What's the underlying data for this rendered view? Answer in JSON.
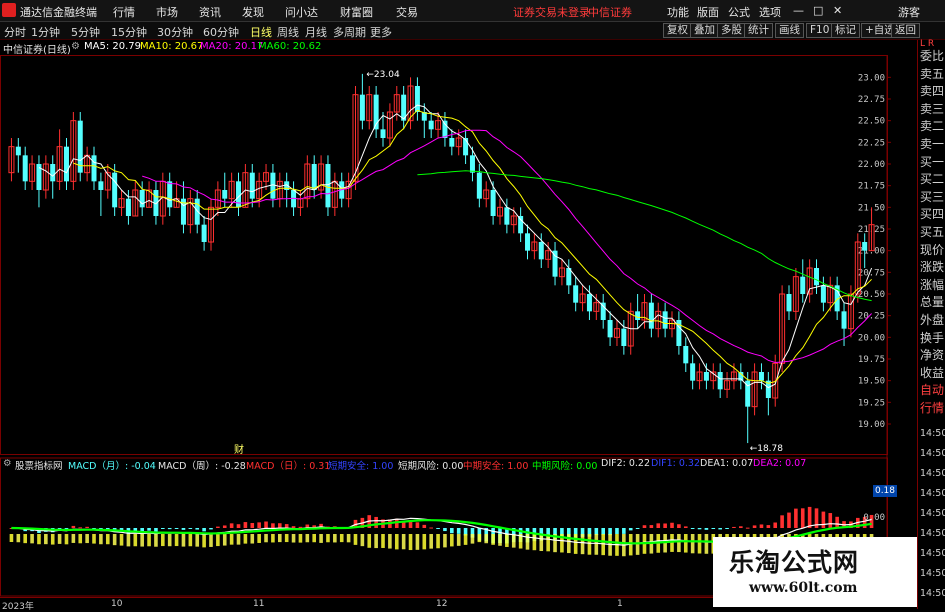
{
  "menubar": {
    "app_title": "通达信金融终端",
    "menus": [
      "行情",
      "市场",
      "资讯",
      "发现",
      "问小达",
      "财富圈",
      "交易"
    ],
    "notice": [
      "证券交易未登录",
      "中信证券"
    ],
    "right_menus": [
      "功能",
      "版面",
      "公式",
      "选项"
    ],
    "window_controls": [
      "—",
      "□",
      "✕"
    ],
    "user": "游客"
  },
  "toolbar": {
    "periods": [
      "分时",
      "1分钟",
      "5分钟",
      "15分钟",
      "30分钟",
      "60分钟",
      "日线",
      "周线",
      "月线",
      "多周期",
      "更多"
    ],
    "active_period": "日线",
    "right_buttons": [
      "复权",
      "叠加",
      "多股",
      "统计",
      "画线",
      "F10",
      "标记",
      "+自选",
      "返回"
    ]
  },
  "main_info": {
    "stock": "中信证券(日线)",
    "ma5": "MA5: 20.79",
    "ma10": "MA10: 20.67",
    "ma20": "MA20: 20.17",
    "ma60": "MA60: 20.62"
  },
  "colors": {
    "up": "#ff3030",
    "down": "#54ffff",
    "ma5": "#ffffff",
    "ma10": "#ffff00",
    "ma20": "#ff00ff",
    "ma60": "#00ff00",
    "grid": "#7a0000",
    "axis_text": "#c8c8c8"
  },
  "price_axis": [
    "23.00",
    "22.75",
    "22.50",
    "22.25",
    "22.00",
    "21.75",
    "21.50",
    "21.25",
    "21.00",
    "20.75",
    "20.50",
    "20.25",
    "20.00",
    "19.75",
    "19.50",
    "19.25",
    "19.00"
  ],
  "annotations": {
    "high": "23.04",
    "low": "18.78",
    "cai_marker": "财"
  },
  "right_panel": {
    "labels": [
      "委比",
      "卖五",
      "卖四",
      "卖三",
      "卖二",
      "卖一",
      "买一",
      "买二",
      "买三",
      "买四",
      "买五",
      "现价",
      "涨跌",
      "涨幅",
      "总量",
      "外盘",
      "换手",
      "净资",
      "收益",
      "自动",
      "行情"
    ],
    "header": "L\nR",
    "times": [
      "14:50",
      "14:50",
      "14:50",
      "14:50",
      "14:50",
      "14:50",
      "14:50",
      "14:50",
      "14:50"
    ]
  },
  "sub_info": {
    "name": "股票指标网",
    "macd_month": "MACD（月）: -0.04",
    "macd_week": "MACD（周）: -0.28",
    "macd_day": "MACD（日）: 0.31",
    "long_safe": "短期安全: 1.00",
    "short_risk": "短期风险: 0.00",
    "mid_safe": "中期安全: 1.00",
    "mid_risk": "中期风险: 0.00",
    "dif2": "DIF2: 0.22",
    "dif1": "DIF1: 0.32",
    "dea1": "DEA1: 0.07",
    "dea2": "DEA2: 0.07",
    "value_badge": "0.18",
    "sub_axis": [
      "0.00",
      "0.00"
    ]
  },
  "x_axis": [
    "2023年",
    "10",
    "11",
    "12",
    "1"
  ],
  "watermark": {
    "line1": "乐淘公式网",
    "line2": "www.60lt.com"
  },
  "chart_data": {
    "type": "candlestick",
    "ylim": [
      18.7,
      23.2
    ],
    "candles": [
      [
        21.9,
        22.2,
        22.3,
        21.8
      ],
      [
        22.2,
        22.1,
        22.3,
        21.9
      ],
      [
        22.1,
        21.8,
        22.2,
        21.7
      ],
      [
        21.8,
        22.0,
        22.1,
        21.7
      ],
      [
        22.0,
        21.7,
        22.1,
        21.5
      ],
      [
        21.7,
        22.0,
        22.1,
        21.6
      ],
      [
        22.0,
        21.8,
        22.1,
        21.6
      ],
      [
        21.8,
        22.2,
        22.4,
        21.7
      ],
      [
        22.2,
        21.8,
        22.3,
        21.7
      ],
      [
        21.8,
        22.5,
        22.6,
        21.7
      ],
      [
        22.5,
        21.9,
        22.6,
        21.8
      ],
      [
        21.9,
        22.1,
        22.2,
        21.8
      ],
      [
        22.1,
        21.8,
        22.2,
        21.7
      ],
      [
        21.8,
        21.7,
        21.9,
        21.4
      ],
      [
        21.7,
        21.9,
        22.0,
        21.6
      ],
      [
        21.9,
        21.5,
        22.0,
        21.4
      ],
      [
        21.5,
        21.6,
        21.7,
        21.4
      ],
      [
        21.6,
        21.4,
        21.7,
        21.3
      ],
      [
        21.4,
        21.7,
        21.8,
        21.4
      ],
      [
        21.7,
        21.5,
        21.8,
        21.4
      ],
      [
        21.5,
        21.7,
        21.8,
        21.5
      ],
      [
        21.7,
        21.4,
        21.8,
        21.3
      ],
      [
        21.4,
        21.8,
        21.9,
        21.3
      ],
      [
        21.8,
        21.5,
        21.9,
        21.4
      ],
      [
        21.5,
        21.6,
        21.8,
        21.5
      ],
      [
        21.6,
        21.3,
        21.8,
        21.2
      ],
      [
        21.3,
        21.6,
        21.7,
        21.2
      ],
      [
        21.6,
        21.3,
        21.7,
        21.2
      ],
      [
        21.3,
        21.1,
        21.4,
        21.0
      ],
      [
        21.1,
        21.5,
        21.6,
        21.0
      ],
      [
        21.5,
        21.7,
        21.8,
        21.4
      ],
      [
        21.7,
        21.6,
        21.9,
        21.5
      ],
      [
        21.6,
        21.8,
        21.9,
        21.5
      ],
      [
        21.8,
        21.5,
        21.9,
        21.4
      ],
      [
        21.5,
        21.9,
        22.0,
        21.5
      ],
      [
        21.9,
        21.6,
        22.0,
        21.5
      ],
      [
        21.6,
        21.8,
        21.9,
        21.5
      ],
      [
        21.8,
        21.9,
        22.0,
        21.7
      ],
      [
        21.9,
        21.6,
        22.0,
        21.5
      ],
      [
        21.6,
        21.8,
        21.9,
        21.5
      ],
      [
        21.8,
        21.7,
        21.9,
        21.5
      ],
      [
        21.7,
        21.5,
        21.8,
        21.4
      ],
      [
        21.5,
        21.6,
        21.7,
        21.4
      ],
      [
        21.6,
        22.0,
        22.1,
        21.5
      ],
      [
        22.0,
        21.7,
        22.1,
        21.6
      ],
      [
        21.7,
        22.0,
        22.1,
        21.6
      ],
      [
        22.0,
        21.5,
        22.1,
        21.4
      ],
      [
        21.5,
        21.8,
        21.9,
        21.4
      ],
      [
        21.8,
        21.6,
        21.9,
        21.5
      ],
      [
        21.6,
        21.8,
        21.9,
        21.5
      ],
      [
        21.8,
        22.8,
        22.9,
        21.7
      ],
      [
        22.8,
        22.5,
        23.04,
        22.4
      ],
      [
        22.5,
        22.8,
        22.9,
        22.4
      ],
      [
        22.8,
        22.4,
        22.9,
        22.3
      ],
      [
        22.4,
        22.3,
        22.6,
        22.2
      ],
      [
        22.3,
        22.6,
        22.7,
        22.2
      ],
      [
        22.6,
        22.8,
        22.9,
        22.5
      ],
      [
        22.8,
        22.5,
        22.9,
        22.4
      ],
      [
        22.5,
        22.9,
        23.0,
        22.4
      ],
      [
        22.9,
        22.6,
        23.0,
        22.5
      ],
      [
        22.6,
        22.5,
        22.7,
        22.3
      ],
      [
        22.5,
        22.4,
        22.6,
        22.3
      ],
      [
        22.4,
        22.5,
        22.6,
        22.3
      ],
      [
        22.5,
        22.3,
        22.6,
        22.2
      ],
      [
        22.3,
        22.2,
        22.4,
        22.1
      ],
      [
        22.2,
        22.3,
        22.4,
        22.1
      ],
      [
        22.3,
        22.1,
        22.4,
        22.0
      ],
      [
        22.1,
        21.9,
        22.2,
        21.8
      ],
      [
        21.9,
        21.6,
        22.0,
        21.5
      ],
      [
        21.6,
        21.7,
        21.8,
        21.5
      ],
      [
        21.7,
        21.4,
        21.8,
        21.3
      ],
      [
        21.4,
        21.5,
        21.6,
        21.3
      ],
      [
        21.5,
        21.3,
        21.6,
        21.2
      ],
      [
        21.3,
        21.4,
        21.5,
        21.2
      ],
      [
        21.4,
        21.2,
        21.5,
        21.1
      ],
      [
        21.2,
        21.0,
        21.3,
        20.9
      ],
      [
        21.0,
        21.1,
        21.2,
        20.9
      ],
      [
        21.1,
        20.9,
        21.2,
        20.8
      ],
      [
        20.9,
        21.0,
        21.1,
        20.8
      ],
      [
        21.0,
        20.7,
        21.1,
        20.6
      ],
      [
        20.7,
        20.8,
        20.9,
        20.6
      ],
      [
        20.8,
        20.6,
        20.9,
        20.5
      ],
      [
        20.6,
        20.4,
        20.7,
        20.3
      ],
      [
        20.4,
        20.5,
        20.6,
        20.3
      ],
      [
        20.5,
        20.3,
        20.6,
        20.2
      ],
      [
        20.3,
        20.4,
        20.5,
        20.2
      ],
      [
        20.4,
        20.2,
        20.5,
        20.1
      ],
      [
        20.2,
        20.0,
        20.3,
        19.9
      ],
      [
        20.0,
        20.1,
        20.2,
        19.9
      ],
      [
        20.1,
        19.9,
        20.2,
        19.8
      ],
      [
        19.9,
        20.3,
        20.4,
        19.8
      ],
      [
        20.3,
        20.2,
        20.5,
        20.1
      ],
      [
        20.2,
        20.4,
        20.5,
        20.1
      ],
      [
        20.4,
        20.1,
        20.5,
        20.0
      ],
      [
        20.1,
        20.3,
        20.4,
        20.0
      ],
      [
        20.3,
        20.1,
        20.4,
        20.0
      ],
      [
        20.1,
        20.2,
        20.3,
        20.0
      ],
      [
        20.2,
        19.9,
        20.3,
        19.8
      ],
      [
        19.9,
        19.7,
        20.0,
        19.6
      ],
      [
        19.7,
        19.5,
        19.8,
        19.4
      ],
      [
        19.5,
        19.6,
        19.7,
        19.4
      ],
      [
        19.6,
        19.5,
        19.7,
        19.4
      ],
      [
        19.5,
        19.6,
        19.7,
        19.4
      ],
      [
        19.6,
        19.4,
        19.7,
        19.3
      ],
      [
        19.4,
        19.5,
        19.6,
        19.3
      ],
      [
        19.5,
        19.6,
        19.7,
        19.4
      ],
      [
        19.6,
        19.5,
        19.7,
        19.4
      ],
      [
        19.5,
        19.2,
        19.6,
        18.78
      ],
      [
        19.2,
        19.6,
        19.7,
        19.1
      ],
      [
        19.6,
        19.5,
        19.7,
        19.4
      ],
      [
        19.5,
        19.3,
        19.6,
        19.1
      ],
      [
        19.3,
        19.7,
        19.8,
        19.2
      ],
      [
        19.7,
        20.5,
        20.6,
        19.6
      ],
      [
        20.5,
        20.3,
        20.6,
        20.2
      ],
      [
        20.3,
        20.7,
        20.8,
        20.2
      ],
      [
        20.7,
        20.5,
        20.9,
        20.4
      ],
      [
        20.5,
        20.8,
        20.9,
        20.4
      ],
      [
        20.8,
        20.6,
        20.9,
        20.5
      ],
      [
        20.6,
        20.4,
        20.7,
        20.3
      ],
      [
        20.4,
        20.6,
        20.7,
        20.3
      ],
      [
        20.6,
        20.3,
        20.7,
        20.2
      ],
      [
        20.3,
        20.1,
        20.4,
        19.9
      ],
      [
        20.1,
        20.5,
        20.6,
        20.0
      ],
      [
        20.5,
        21.1,
        21.2,
        20.4
      ],
      [
        21.1,
        21.0,
        21.2,
        20.8
      ],
      [
        21.0,
        21.3,
        21.5,
        21.0
      ]
    ]
  }
}
